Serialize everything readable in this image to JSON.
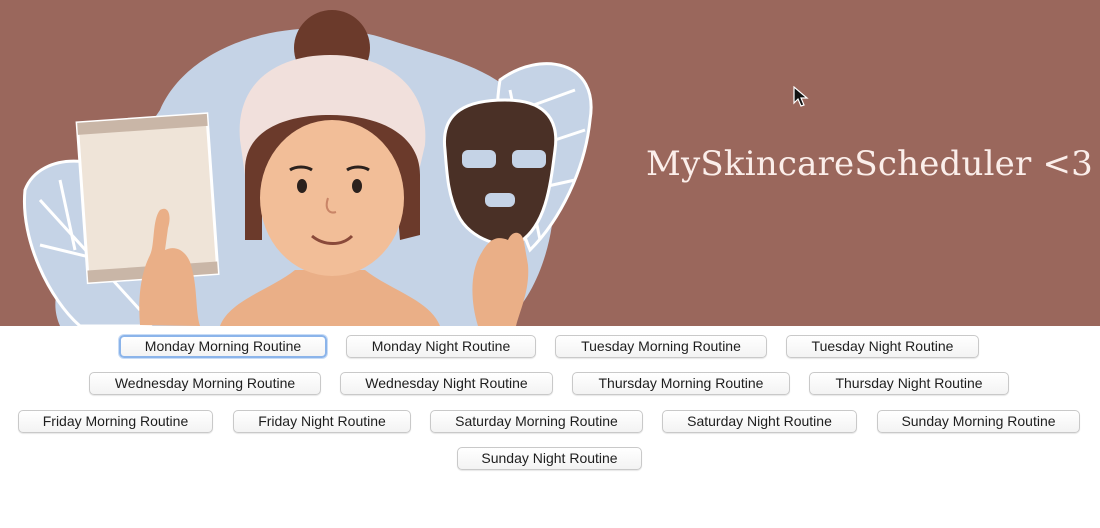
{
  "header": {
    "title": "MySkincareScheduler <3",
    "illustration": "woman-with-towel-holding-face-mask-illustration",
    "background_color": "#9a675c"
  },
  "routines": [
    {
      "label": "Monday Morning Routine",
      "focused": true
    },
    {
      "label": "Monday Night Routine"
    },
    {
      "label": "Tuesday Morning Routine"
    },
    {
      "label": "Tuesday Night Routine"
    },
    {
      "label": "Wednesday Morning Routine"
    },
    {
      "label": "Wednesday Night Routine"
    },
    {
      "label": "Thursday Morning Routine"
    },
    {
      "label": "Thursday Night Routine"
    },
    {
      "label": "Friday Morning Routine"
    },
    {
      "label": "Friday Night Routine"
    },
    {
      "label": "Saturday Morning Routine"
    },
    {
      "label": "Saturday Night Routine"
    },
    {
      "label": "Sunday Morning Routine"
    },
    {
      "label": "Sunday Night Routine"
    }
  ]
}
